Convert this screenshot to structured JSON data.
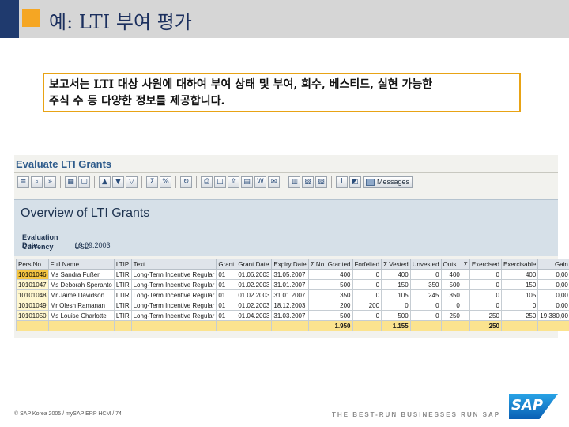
{
  "slide": {
    "title": "예: LTI 부여 평가",
    "callout_line1": "보고서는 LTI 대상 사원에 대하여 부여 상태 및 부여, 회수, 베스티드, 실현 가능한",
    "callout_line2": "주식 수 등 다양한 정보를 제공합니다."
  },
  "window": {
    "title": "Evaluate LTI Grants",
    "messages_label": "Messages"
  },
  "toolbar": {
    "icons": [
      "details-icon",
      "find-icon",
      "find-next-icon",
      "select-icon",
      "deselect-icon",
      "sort-asc-icon",
      "sort-desc-icon",
      "filter-icon",
      "sum-icon",
      "subtotal-icon",
      "refresh-icon",
      "print-icon",
      "print-preview-icon",
      "export-icon",
      "excel-icon",
      "word-icon",
      "mail-icon",
      "layout-icon",
      "choose-layout-icon",
      "save-layout-icon",
      "info-icon",
      "graphic-icon"
    ]
  },
  "report": {
    "heading": "Overview of LTI Grants",
    "eval_date_label": "Evaluation Date",
    "eval_date_value": "19.09.2003",
    "currency_label": "Currency",
    "currency_value": "USD"
  },
  "table": {
    "columns": [
      "Pers.No.",
      "Full Name",
      "LTIP",
      "Text",
      "Grant",
      "Grant Date",
      "Expiry Date",
      "Σ No. Granted",
      "Forfeited",
      "Σ Vested",
      "Unvested",
      "Outs..",
      "Σ",
      "Exercised",
      "Exercisable",
      "Gain"
    ],
    "rows": [
      [
        "10101046",
        "Ms Sandra Fußer",
        "LTIR",
        "Long-Term Incentive Regular",
        "01",
        "01.06.2003",
        "31.05.2007",
        "400",
        "0",
        "400",
        "0",
        "400",
        "",
        "0",
        "400",
        "0,00"
      ],
      [
        "10101047",
        "Ms Deborah Speranto",
        "LTIR",
        "Long-Term Incentive Regular",
        "01",
        "01.02.2003",
        "31.01.2007",
        "500",
        "0",
        "150",
        "350",
        "500",
        "",
        "0",
        "150",
        "0,00"
      ],
      [
        "10101048",
        "Mr Jaime Davidson",
        "LTIR",
        "Long-Term Incentive Regular",
        "01",
        "01.02.2003",
        "31.01.2007",
        "350",
        "0",
        "105",
        "245",
        "350",
        "",
        "0",
        "105",
        "0,00"
      ],
      [
        "10101049",
        "Mr Olesh Ramanan",
        "LTIR",
        "Long-Term Incentive Regular",
        "01",
        "01.02.2003",
        "18.12.2003",
        "200",
        "200",
        "0",
        "0",
        "0",
        "",
        "0",
        "0",
        "0,00"
      ],
      [
        "10101050",
        "Ms Louise Charlotte",
        "LTIR",
        "Long-Term Incentive Regular",
        "01",
        "01.04.2003",
        "31.03.2007",
        "500",
        "0",
        "500",
        "0",
        "250",
        "",
        "250",
        "250",
        "19.380,00"
      ]
    ],
    "totals": [
      "",
      "",
      "",
      "",
      "",
      "",
      "",
      "1.950",
      "",
      "1.155",
      "",
      "",
      "",
      "250",
      "",
      ""
    ]
  },
  "footer": {
    "copyright": "©  SAP Korea 2005 / mySAP ERP HCM / 74",
    "tagline": "THE BEST-RUN BUSINESSES RUN SAP",
    "logo": "SAP"
  },
  "colors": {
    "header_bar": "#d6d6d6",
    "accent_orange": "#f5a623",
    "accent_navy": "#1f3a6e",
    "callout_border": "#e8a315",
    "sap_title": "#2f5c8c",
    "panel_bg": "#d6e0e8",
    "total_row": "#fbe38f"
  }
}
